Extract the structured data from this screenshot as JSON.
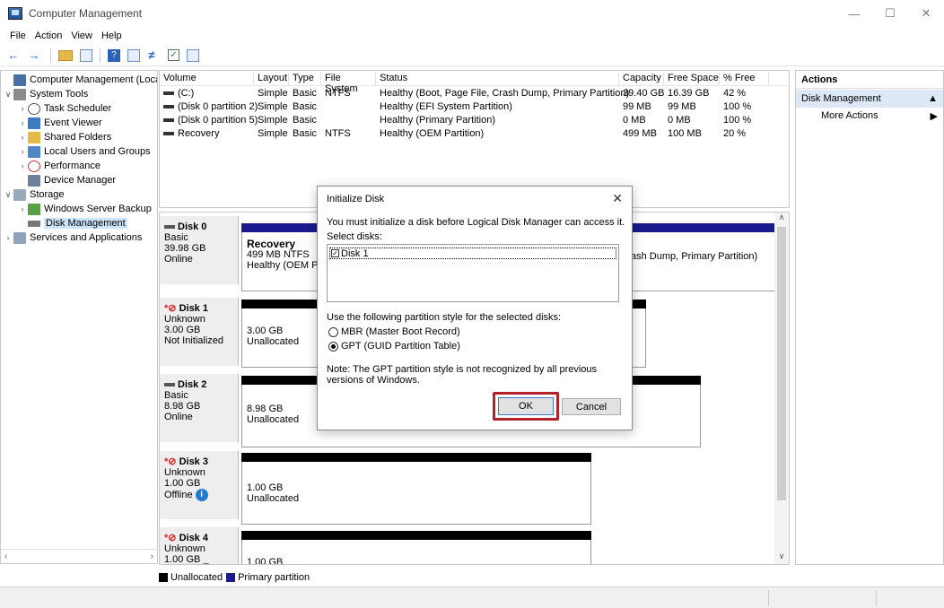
{
  "window": {
    "title": "Computer Management",
    "min_glyph": "—",
    "max_glyph": "☐",
    "close_glyph": "✕"
  },
  "menu": [
    "File",
    "Action",
    "View",
    "Help"
  ],
  "tree": {
    "items": [
      {
        "label": "Computer Management (Local",
        "icon": "computer-icon"
      },
      {
        "label": "System Tools",
        "icon": "tools-icon"
      },
      {
        "label": "Task Scheduler",
        "icon": "clock-icon"
      },
      {
        "label": "Event Viewer",
        "icon": "event-viewer-icon"
      },
      {
        "label": "Shared Folders",
        "icon": "shared-folder-icon"
      },
      {
        "label": "Local Users and Groups",
        "icon": "users-icon"
      },
      {
        "label": "Performance",
        "icon": "performance-icon"
      },
      {
        "label": "Device Manager",
        "icon": "device-manager-icon"
      },
      {
        "label": "Storage",
        "icon": "storage-icon"
      },
      {
        "label": "Windows Server Backup",
        "icon": "backup-icon"
      },
      {
        "label": "Disk Management",
        "icon": "disk-icon"
      },
      {
        "label": "Services and Applications",
        "icon": "services-icon"
      }
    ]
  },
  "volumes": {
    "headers": [
      "Volume",
      "Layout",
      "Type",
      "File System",
      "Status",
      "Capacity",
      "Free Space",
      "% Free"
    ],
    "rows": [
      [
        "(C:)",
        "Simple",
        "Basic",
        "NTFS",
        "Healthy (Boot, Page File, Crash Dump, Primary Partition)",
        "39.40 GB",
        "16.39 GB",
        "42 %"
      ],
      [
        "(Disk 0 partition 2)",
        "Simple",
        "Basic",
        "",
        "Healthy (EFI System Partition)",
        "99 MB",
        "99 MB",
        "100 %"
      ],
      [
        "(Disk 0 partition 5)",
        "Simple",
        "Basic",
        "",
        "Healthy (Primary Partition)",
        "0 MB",
        "0 MB",
        "100 %"
      ],
      [
        "Recovery",
        "Simple",
        "Basic",
        "NTFS",
        "Healthy (OEM Partition)",
        "499 MB",
        "100 MB",
        "20 %"
      ]
    ]
  },
  "disks": [
    {
      "name": "Disk 0",
      "type": "Basic",
      "size": "39.98 GB",
      "state": "Online",
      "part_title": "Recovery",
      "part_line2": "499 MB NTFS",
      "part_line3": "Healthy (OEM Pa",
      "part_tail": "ash Dump, Primary Partition)"
    },
    {
      "name": "Disk 1",
      "prefix": "*",
      "type": "Unknown",
      "size": "3.00 GB",
      "state": "Not Initialized",
      "part_line2": "3.00 GB",
      "part_line3": "Unallocated"
    },
    {
      "name": "Disk 2",
      "type": "Basic",
      "size": "8.98 GB",
      "state": "Online",
      "part_line2": "8.98 GB",
      "part_line3": "Unallocated"
    },
    {
      "name": "Disk 3",
      "prefix": "*",
      "type": "Unknown",
      "size": "1.00 GB",
      "state": "Offline",
      "part_line2": "1.00 GB",
      "part_line3": "Unallocated"
    },
    {
      "name": "Disk 4",
      "prefix": "*",
      "type": "Unknown",
      "size": "1.00 GB _",
      "part_line2": "1.00 GB"
    }
  ],
  "legend": [
    {
      "label": "Unallocated",
      "color": "#000000"
    },
    {
      "label": "Primary partition",
      "color": "#1a1a8c"
    }
  ],
  "actions": {
    "header": "Actions",
    "section": "Disk Management",
    "more": "More Actions"
  },
  "dialog": {
    "title": "Initialize Disk",
    "intro": "You must initialize a disk before Logical Disk Manager can access it.",
    "select_label": "Select disks:",
    "disk_item": "Disk 1",
    "style_label": "Use the following partition style for the selected disks:",
    "mbr": "MBR (Master Boot Record)",
    "gpt": "GPT (GUID Partition Table)",
    "selected_style": "gpt",
    "note": "Note: The GPT partition style is not recognized by all previous versions of Windows.",
    "ok": "OK",
    "cancel": "Cancel",
    "highlight_color": "#b3202a"
  }
}
